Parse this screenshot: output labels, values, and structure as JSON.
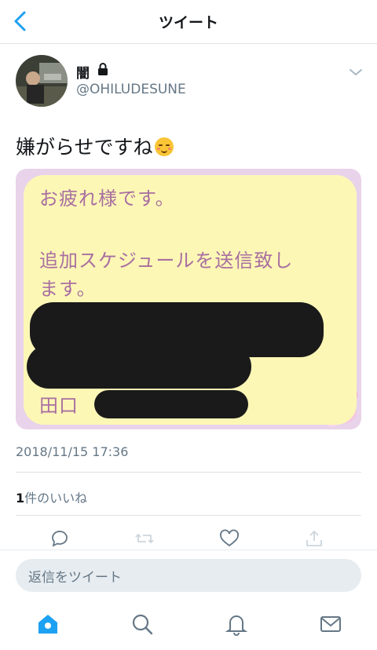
{
  "header": {
    "title": "ツイート"
  },
  "user": {
    "name": "闇",
    "handle": "@OHILUDESUNE"
  },
  "tweet": {
    "text": "嫌がらせですね",
    "emoji": "relaxed-face-emoji",
    "image": {
      "line1": "お疲れ様です。",
      "line2": "追加スケジュールを送信致し",
      "line3": "ます。",
      "signature": "田口"
    },
    "timestamp": "2018/11/15 17:36",
    "likes_count": "1",
    "likes_suffix": "件のいいね"
  },
  "reply": {
    "placeholder": "返信をツイート"
  },
  "colors": {
    "accent": "#1da1f2",
    "muted": "#657786",
    "bubble": "#fdf7b6",
    "bubble_text": "#a86fa0"
  },
  "icons": [
    "back-arrow-icon",
    "lock-icon",
    "chevron-down-icon",
    "reply-icon",
    "retweet-icon",
    "like-icon",
    "share-icon",
    "home-icon",
    "search-icon",
    "notifications-icon",
    "messages-icon"
  ]
}
